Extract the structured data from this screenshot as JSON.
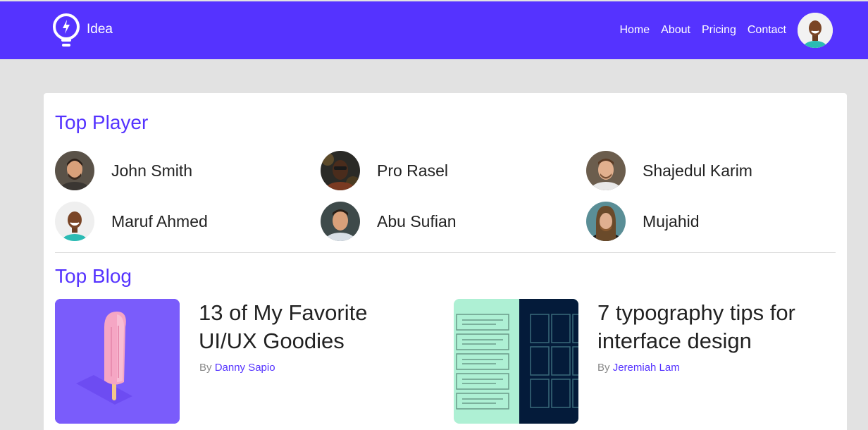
{
  "nav": {
    "brand": "Idea",
    "links": [
      "Home",
      "About",
      "Pricing",
      "Contact"
    ]
  },
  "players_section": {
    "title": "Top Player",
    "players": [
      {
        "name": "John Smith"
      },
      {
        "name": "Pro Rasel"
      },
      {
        "name": "Shajedul Karim"
      },
      {
        "name": "Maruf Ahmed"
      },
      {
        "name": "Abu Sufian"
      },
      {
        "name": "Mujahid"
      }
    ]
  },
  "blog_section": {
    "title": "Top Blog",
    "posts": [
      {
        "title": "13 of My Favorite UI/UX Goodies",
        "by": "By",
        "author": "Danny Sapio"
      },
      {
        "title": "7 typography tips for interface design",
        "by": "By",
        "author": "Jeremiah Lam"
      }
    ]
  },
  "colors": {
    "accent": "#5533ff",
    "background": "#e2e2e2",
    "card": "#ffffff"
  }
}
